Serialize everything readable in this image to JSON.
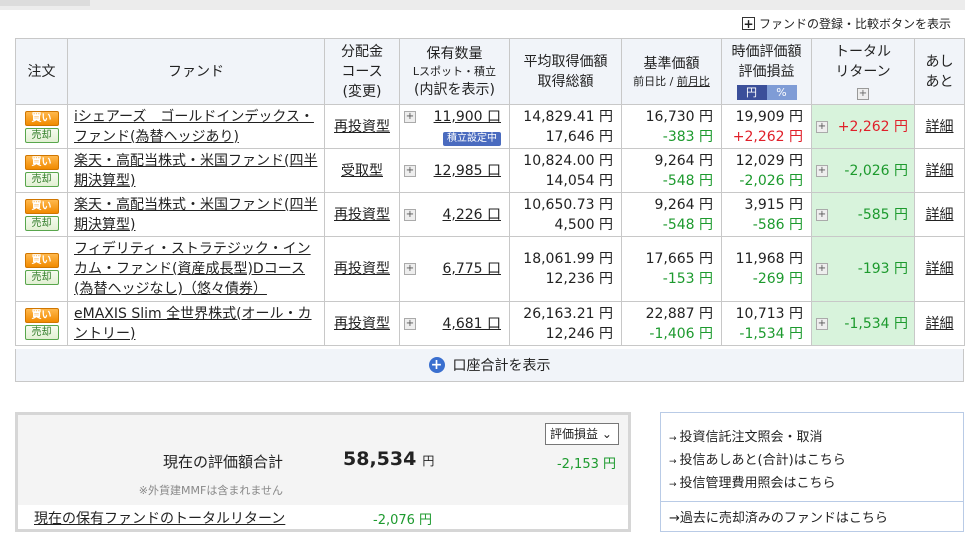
{
  "compare_link": "ファンドの登録・比較ボタンを表示",
  "headers": {
    "order": "注文",
    "fund": "ファンド",
    "dist": [
      "分配金",
      "コース",
      "(変更)"
    ],
    "qty": [
      "保有数量",
      "Lスポット・積立",
      "(内訳を表示)"
    ],
    "avg": [
      "平均取得価額",
      "取得総額"
    ],
    "base": "基準価額",
    "base_day": "前日比",
    "base_month": "前月比",
    "eval": [
      "時価評価額",
      "評価損益"
    ],
    "eval_yen": "円",
    "eval_pct": "%",
    "total": [
      "トータル",
      "リターン"
    ],
    "hist": [
      "あし",
      "あと"
    ]
  },
  "buy_label": "買い",
  "sell_label": "売却",
  "detail_label": "詳細",
  "funds": [
    {
      "name": "iシェアーズ　ゴールドインデックス・ファンド(為替ヘッジあり)",
      "dist": "再投資型",
      "qty": "11,900 口",
      "badge": "積立設定中",
      "avg_price": "14,829.41 円",
      "avg_total": "17,646 円",
      "base": "16,730 円",
      "base_chg": "-383 円",
      "eval": "19,909 円",
      "eval_pl": "+2,262 円",
      "total": "+2,262 円"
    },
    {
      "name": "楽天・高配当株式・米国ファンド(四半期決算型)",
      "dist": "受取型",
      "qty": "12,985 口",
      "badge": "",
      "avg_price": "10,824.00 円",
      "avg_total": "14,054 円",
      "base": "9,264 円",
      "base_chg": "-548 円",
      "eval": "12,029 円",
      "eval_pl": "-2,026 円",
      "total": "-2,026 円"
    },
    {
      "name": "楽天・高配当株式・米国ファンド(四半期決算型)",
      "dist": "再投資型",
      "qty": "4,226 口",
      "badge": "",
      "avg_price": "10,650.73 円",
      "avg_total": "4,500 円",
      "base": "9,264 円",
      "base_chg": "-548 円",
      "eval": "3,915 円",
      "eval_pl": "-586 円",
      "total": "-585 円"
    },
    {
      "name": "フィデリティ・ストラテジック・インカム・ファンド(資産成長型)Dコース(為替ヘッジなし)（悠々債券）",
      "dist": "再投資型",
      "qty": "6,775 口",
      "badge": "",
      "avg_price": "18,061.99 円",
      "avg_total": "12,236 円",
      "base": "17,665 円",
      "base_chg": "-153 円",
      "eval": "11,968 円",
      "eval_pl": "-269 円",
      "total": "-193 円"
    },
    {
      "name": "eMAXIS Slim 全世界株式(オール・カントリー)",
      "dist": "再投資型",
      "qty": "4,681 口",
      "badge": "",
      "avg_price": "26,163.21 円",
      "avg_total": "12,246 円",
      "base": "22,887 円",
      "base_chg": "-1,406 円",
      "eval": "10,713 円",
      "eval_pl": "-1,534 円",
      "total": "-1,534 円"
    }
  ],
  "account_total_link": "口座合計を表示",
  "valuation": {
    "select_value": "評価損益",
    "label": "現在の評価額合計",
    "amount": "58,534",
    "amount_unit": "円",
    "gain": "-2,153 円",
    "note": "※外貨建MMFは含まれません",
    "total_return_label": "現在の保有ファンドのトータルリターン",
    "total_return": "-2,076 円"
  },
  "links": [
    "投資信託注文照会・取消",
    "投信あしあと(合計)はこちら",
    "投信管理費用照会はこちら"
  ],
  "sold_funds_link": "過去に売却済みのファンドはこちら"
}
